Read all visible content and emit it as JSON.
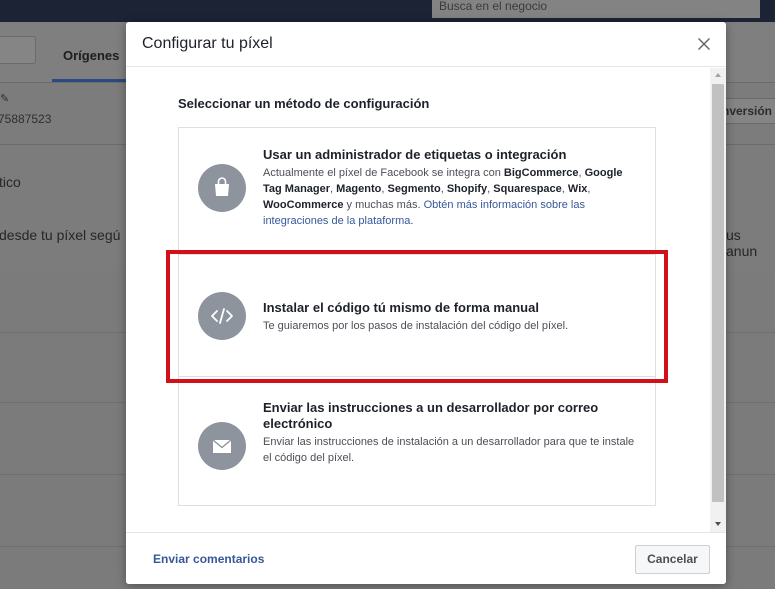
{
  "background": {
    "search_placeholder": "Busca en el negocio",
    "tab_label": "Orígenes",
    "id_fragment": "75887523",
    "conversion_button": "nversión",
    "row_text_1": "tico",
    "row_text_2": "desde tu píxel segú",
    "row_text_3": "us anun"
  },
  "modal": {
    "title": "Configurar tu píxel",
    "section_title": "Seleccionar un método de configuración",
    "options": [
      {
        "icon": "shopping-bag-icon",
        "title": "Usar un administrador de etiquetas o integración",
        "desc_intro": "Actualmente el píxel de Facebook se integra con ",
        "integrations": [
          "BigCommerce",
          "Google Tag Manager",
          "Magento",
          "Segmento",
          "Shopify",
          "Squarespace",
          "Wix",
          "WooCommerce"
        ],
        "desc_tail": " y muchas más. ",
        "link_text": "Obtén más información sobre las integraciones de la plataforma",
        "link_suffix": "."
      },
      {
        "icon": "code-icon",
        "title": "Instalar el código tú mismo de forma manual",
        "description": "Te guiaremos por los pasos de instalación del código del píxel.",
        "highlighted": true
      },
      {
        "icon": "envelope-icon",
        "title": "Enviar las instrucciones a un desarrollador por correo electrónico",
        "description": "Enviar las instrucciones de instalación a un desarrollador para que te instale el código del píxel."
      }
    ],
    "footer": {
      "feedback_label": "Enviar comentarios",
      "cancel_label": "Cancelar"
    }
  },
  "colors": {
    "highlight": "#d0111b",
    "link": "#365899",
    "icon_circle": "#8d949e"
  }
}
